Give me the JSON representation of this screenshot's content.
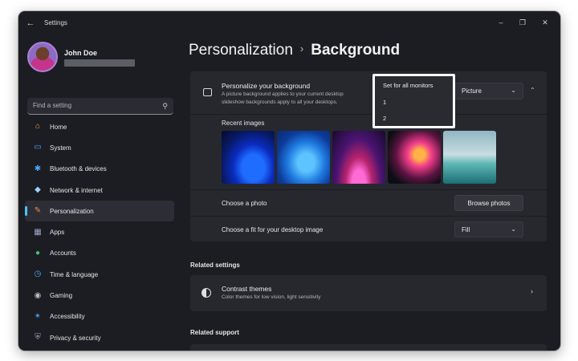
{
  "window": {
    "title": "Settings"
  },
  "profile": {
    "name": "John Doe"
  },
  "search": {
    "placeholder": "Find a setting"
  },
  "sidebar": {
    "items": [
      {
        "label": "Home",
        "icon": "home-icon",
        "color": "#f0a24a"
      },
      {
        "label": "System",
        "icon": "monitor-icon",
        "color": "#4aa8ff"
      },
      {
        "label": "Bluetooth & devices",
        "icon": "bluetooth-icon",
        "color": "#4aa8ff"
      },
      {
        "label": "Network & internet",
        "icon": "wifi-icon",
        "color": "#9bd2ff"
      },
      {
        "label": "Personalization",
        "icon": "brush-icon",
        "color": "#f08a4a",
        "active": true
      },
      {
        "label": "Apps",
        "icon": "apps-icon",
        "color": "#9aa6c8"
      },
      {
        "label": "Accounts",
        "icon": "person-icon",
        "color": "#3cc57a"
      },
      {
        "label": "Time & language",
        "icon": "globe-clock-icon",
        "color": "#4aa8ff"
      },
      {
        "label": "Gaming",
        "icon": "gamepad-icon",
        "color": "#b8bcc8"
      },
      {
        "label": "Accessibility",
        "icon": "accessibility-icon",
        "color": "#4aa8ff"
      },
      {
        "label": "Privacy & security",
        "icon": "shield-icon",
        "color": "#9aa6c8"
      }
    ]
  },
  "breadcrumb": {
    "parent": "Personalization",
    "separator": "›",
    "current": "Background"
  },
  "background": {
    "title": "Personalize your background",
    "subtitle_line1": "A picture background applies to your current desktop",
    "subtitle_line2": "slideshow backgrounds apply to all your desktops.",
    "type_value": "Picture",
    "recent_label": "Recent images",
    "choose_photo_label": "Choose a photo",
    "browse_label": "Browse photos",
    "fit_label": "Choose a fit for your desktop image",
    "fit_value": "Fill"
  },
  "monitor_menu": {
    "items": [
      "Set for all monitors",
      "1",
      "2"
    ]
  },
  "related_settings": {
    "heading": "Related settings",
    "contrast_title": "Contrast themes",
    "contrast_subtitle": "Color themes for low vision, light sensitivity"
  },
  "related_support": {
    "heading": "Related support"
  },
  "accent_color": "#4cc2ff"
}
